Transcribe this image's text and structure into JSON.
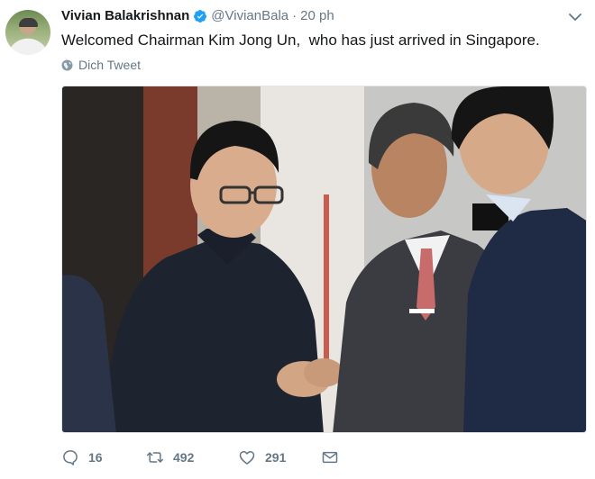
{
  "author": {
    "name": "Vivian Balakrishnan",
    "handle": "@VivianBala",
    "separator": "·",
    "time": "20 ph"
  },
  "tweet": {
    "text": "Welcomed Chairman Kim Jong Un,  who has just arrived in Singapore.",
    "translate_label": "Dich Tweet"
  },
  "actions": {
    "replies": "16",
    "retweets": "492",
    "likes": "291"
  },
  "icons": {
    "verified": "verified-badge-icon",
    "caret": "chevron-down-icon",
    "translate": "globe-icon",
    "reply": "reply-icon",
    "retweet": "retweet-icon",
    "like": "heart-icon",
    "message": "envelope-icon"
  },
  "colors": {
    "verified_blue": "#1da1f2",
    "secondary_text": "#657786",
    "primary_text": "#14171a"
  }
}
